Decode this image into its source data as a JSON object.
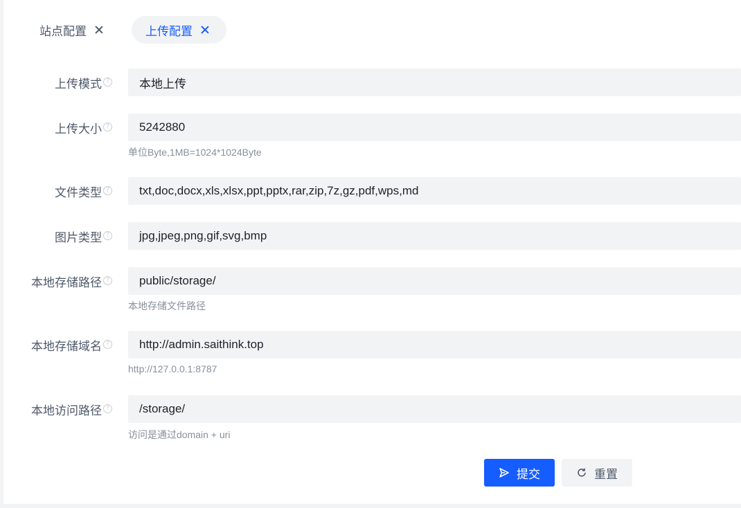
{
  "tabs": [
    {
      "label": "站点配置",
      "active": false
    },
    {
      "label": "上传配置",
      "active": true
    }
  ],
  "form": {
    "fields": [
      {
        "label": "上传模式",
        "value": "本地上传",
        "hint": ""
      },
      {
        "label": "上传大小",
        "value": "5242880",
        "hint": "单位Byte,1MB=1024*1024Byte"
      },
      {
        "label": "文件类型",
        "value": "txt,doc,docx,xls,xlsx,ppt,pptx,rar,zip,7z,gz,pdf,wps,md",
        "hint": ""
      },
      {
        "label": "图片类型",
        "value": "jpg,jpeg,png,gif,svg,bmp",
        "hint": ""
      },
      {
        "label": "本地存储路径",
        "value": "public/storage/",
        "hint": "本地存储文件路径"
      },
      {
        "label": "本地存储域名",
        "value": "http://admin.saithink.top",
        "hint": "http://127.0.0.1:8787"
      },
      {
        "label": "本地访问路径",
        "value": "/storage/",
        "hint": "访问是通过domain + uri"
      }
    ],
    "help_icon_glyph": "?"
  },
  "actions": {
    "submit_label": "提交",
    "reset_label": "重置"
  },
  "colors": {
    "primary": "#165dff",
    "input_bg": "#f2f3f5",
    "hint": "#86909c"
  }
}
